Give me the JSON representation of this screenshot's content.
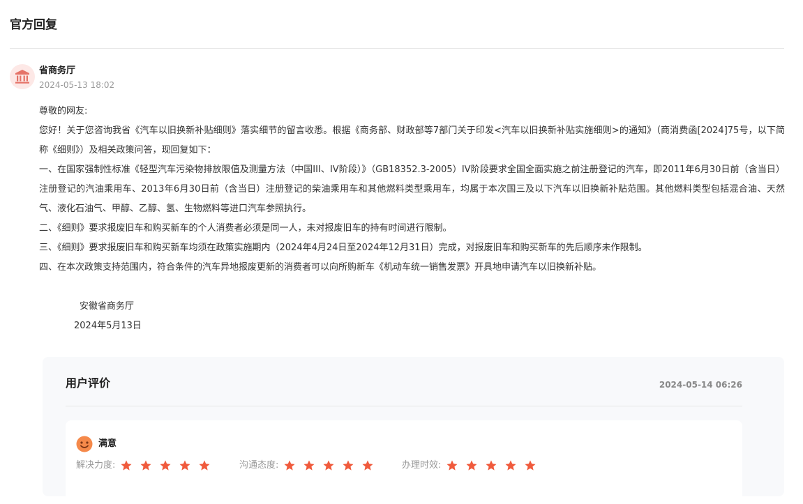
{
  "section": {
    "title": "官方回复"
  },
  "reply": {
    "department": "省商务厅",
    "time": "2024-05-13 18:02",
    "paragraphs": [
      "尊敬的网友:",
      "您好！关于您咨询我省《汽车以旧换新补贴细则》落实细节的留言收悉。根据《商务部、财政部等7部门关于印发<汽车以旧换新补贴实施细则>的通知》（商消费函[2024]75号，以下简称《细则》）及相关政策问答，现回复如下：",
      "一、在国家强制性标准《轻型汽车污染物排放限值及测量方法（中国III、IV阶段）》（GB18352.3-2005）IV阶段要求全国全面实施之前注册登记的汽车，即2011年6月30日前（含当日）注册登记的汽油乘用车、2013年6月30日前（含当日）注册登记的柴油乘用车和其他燃料类型乘用车，均属于本次国三及以下汽车以旧换新补贴范围。其他燃料类型包括混合油、天然气、液化石油气、甲醇、乙醇、氢、生物燃料等进口汽车参照执行。",
      "二、《细则》要求报废旧车和购买新车的个人消费者必须是同一人，未对报废旧车的持有时间进行限制。",
      "三、《细则》要求报废旧车和购买新车均须在政策实施期内（2024年4月24日至2024年12月31日）完成，对报废旧车和购买新车的先后顺序未作限制。",
      "四、在本次政策支持范围内，符合条件的汽车异地报废更新的消费者可以向所购新车《机动车统一销售发票》开具地申请汽车以旧换新补贴。"
    ],
    "signature_org": "安徽省商务厅",
    "signature_date": "2024年5月13日"
  },
  "evaluation": {
    "title": "用户评价",
    "time": "2024-05-14 06:26",
    "result": "满意",
    "ratings": [
      {
        "label": "解决力度:",
        "stars": 5
      },
      {
        "label": "沟通态度:",
        "stars": 5
      },
      {
        "label": "办理时效:",
        "stars": 5
      }
    ]
  },
  "colors": {
    "star": "#f05a3c",
    "face": "#f5894a",
    "avatar_bg": "#fde8e6",
    "avatar_icon": "#e57368"
  },
  "icons": {
    "avatar": "government-building-icon",
    "result": "smiley-face-icon",
    "rating": "star-icon"
  }
}
